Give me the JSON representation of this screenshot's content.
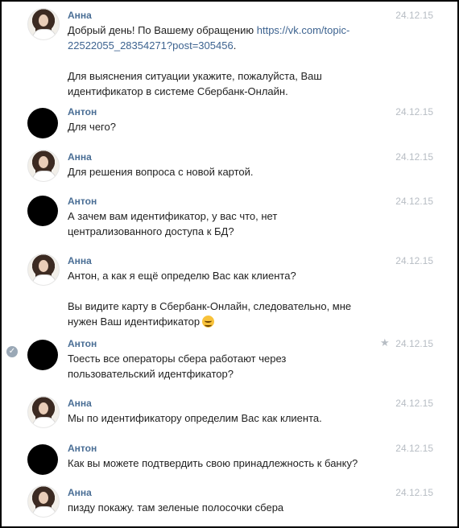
{
  "messages": [
    {
      "author": "Анна",
      "date": "24.12.15",
      "text_prefix": "Добрый день! По Вашему обращению ",
      "link": "https://vk.com/topic-22522055_28354271?post=305456",
      "text_suffix": ".",
      "text2": "Для выяснения ситуации укажите, пожалуйста, Ваш идентификатор в системе Сбербанк-Онлайн."
    },
    {
      "author": "Антон",
      "date": "24.12.15",
      "text": "Для чего?"
    },
    {
      "author": "Анна",
      "date": "24.12.15",
      "text": "Для решения вопроса с новой картой."
    },
    {
      "author": "Антон",
      "date": "24.12.15",
      "text": "А зачем вам идентификатор, у вас что, нет централизованного доступа к БД?"
    },
    {
      "author": "Анна",
      "date": "24.12.15",
      "text": "Антон, а как я ещё определю Вас как клиента?",
      "text2": "Вы видите карту в Сбербанк-Онлайн, следовательно, мне нужен Ваш идентификатор"
    },
    {
      "author": "Антон",
      "date": "24.12.15",
      "text": "Тоесть все операторы сбера работают через пользовательский идентфикатор?"
    },
    {
      "author": "Анна",
      "date": "24.12.15",
      "text": "Мы по идентификатору определим Вас как клиента."
    },
    {
      "author": "Антон",
      "date": "24.12.15",
      "text": "Как вы можете подтвердить свою принадлежность к банку?"
    },
    {
      "author": "Анна",
      "date": "24.12.15",
      "text": "пизду покажу. там зеленые полосочки сбера"
    }
  ],
  "icons": {
    "selected_check": "check-icon",
    "favorite": "star-icon",
    "emoji": "smile-emoji-icon"
  },
  "colors": {
    "author": "#4a6e95",
    "date": "#b7bdc4",
    "link": "#3d6390"
  }
}
